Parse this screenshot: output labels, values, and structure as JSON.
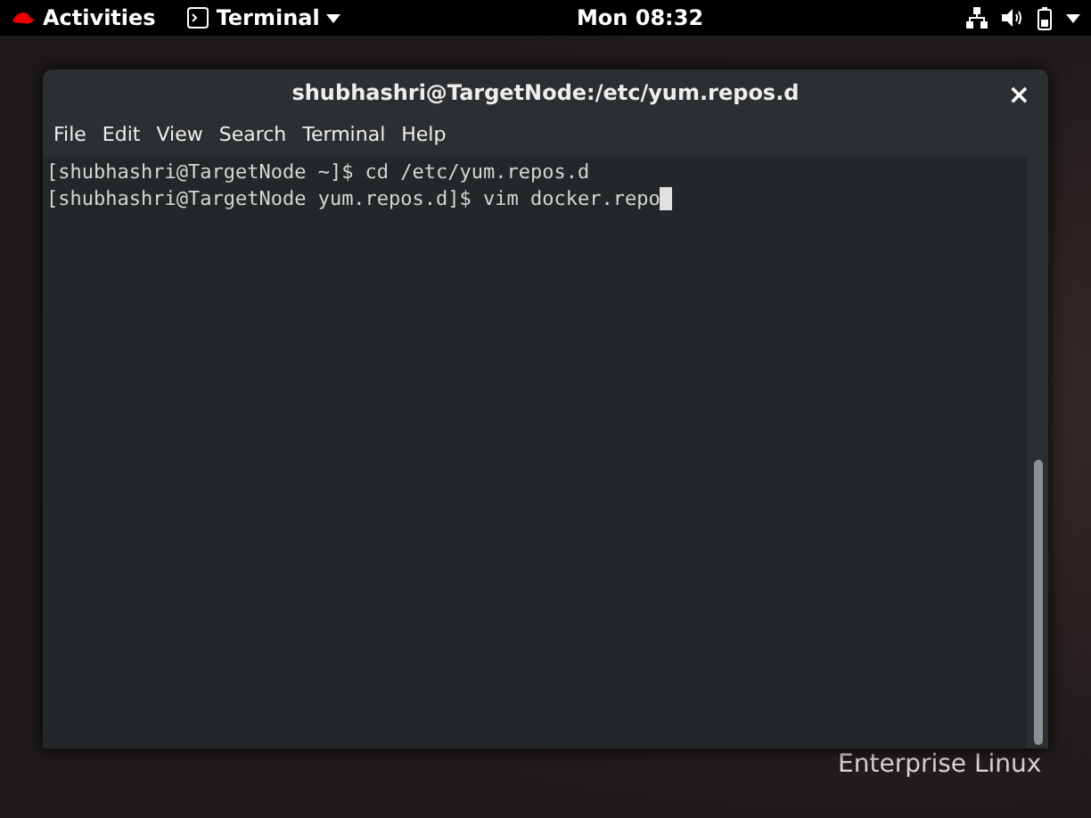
{
  "top_bar": {
    "activities": "Activities",
    "app_menu": "Terminal",
    "clock": "Mon 08:32"
  },
  "window": {
    "title": "shubhashri@TargetNode:/etc/yum.repos.d",
    "close": "×"
  },
  "menu": [
    "File",
    "Edit",
    "View",
    "Search",
    "Terminal",
    "Help"
  ],
  "terminal": {
    "lines": [
      "[shubhashri@TargetNode ~]$ cd /etc/yum.repos.d",
      "[shubhashri@TargetNode yum.repos.d]$ vim docker.repo"
    ]
  },
  "desktop": {
    "branding": "Enterprise Linux"
  }
}
